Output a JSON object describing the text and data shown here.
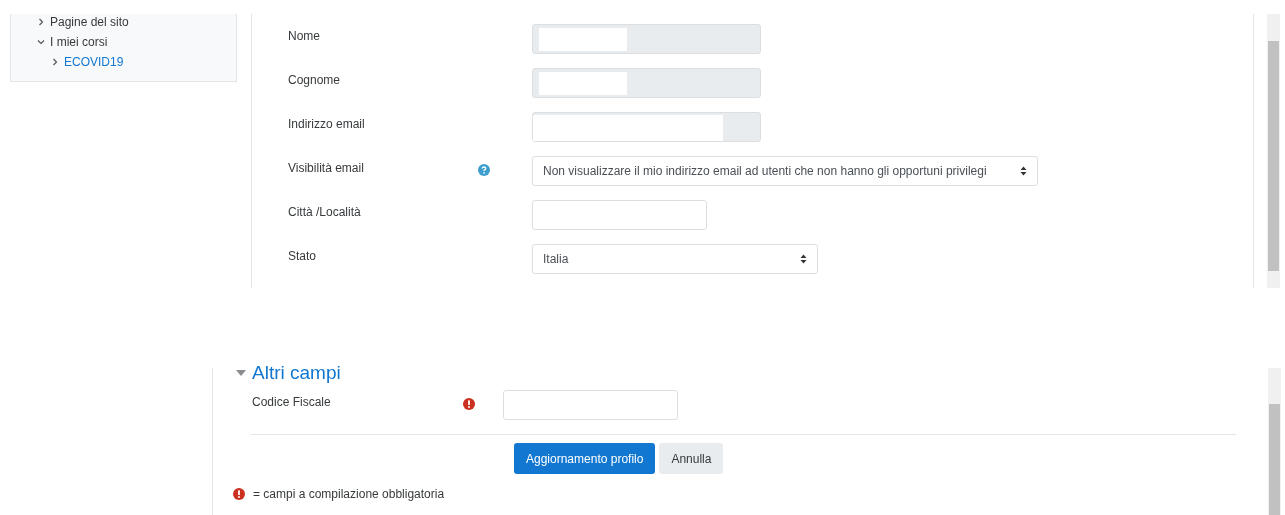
{
  "sidebar": {
    "items": [
      {
        "label": "Pagine del sito",
        "expanded": false,
        "link": false
      },
      {
        "label": "I miei corsi",
        "expanded": true,
        "link": false,
        "children": [
          {
            "label": "ECOVID19",
            "expanded": false,
            "link": true
          }
        ]
      }
    ]
  },
  "profile_form": {
    "fields": [
      {
        "label": "Nome",
        "kind": "readonly",
        "help": false
      },
      {
        "label": "Cognome",
        "kind": "readonly",
        "help": false
      },
      {
        "label": "Indirizzo email",
        "kind": "readonly-wide",
        "help": false
      },
      {
        "label": "Visibilità email",
        "kind": "select",
        "help": true,
        "value": "Non visualizzare il mio indirizzo email ad utenti che non hanno gli opportuni privilegi"
      },
      {
        "label": "Città /Località",
        "kind": "text",
        "help": false
      },
      {
        "label": "Stato",
        "kind": "select-short",
        "help": false,
        "value": "Italia"
      }
    ]
  },
  "other_fields": {
    "title": "Altri campi",
    "expanded": true,
    "fields": [
      {
        "label": "Codice Fiscale",
        "required": true,
        "kind": "text"
      }
    ],
    "buttons": [
      {
        "label": "Aggiornamento profilo",
        "primary": true
      },
      {
        "label": "Annulla",
        "primary": false
      }
    ],
    "legend": "= campi a compilazione obbligatoria"
  }
}
